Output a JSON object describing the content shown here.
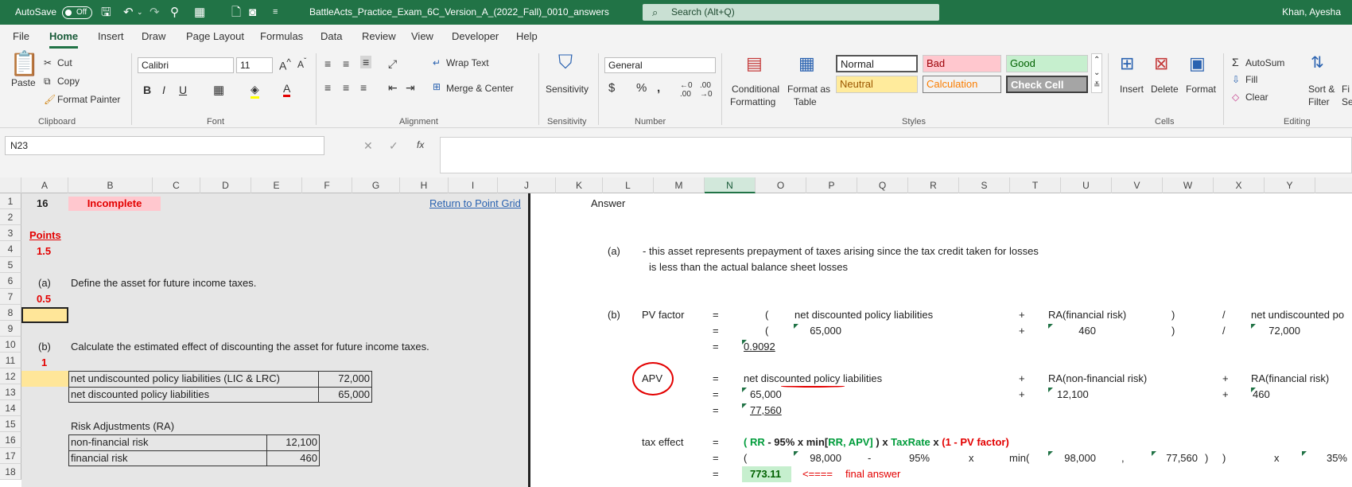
{
  "titlebar": {
    "autosave": "AutoSave",
    "toggle": "Off",
    "filename": "BattleActs_Practice_Exam_6C_Version_A_(2022_Fall)_0010_answers",
    "search": "Search (Alt+Q)",
    "user": "Khan, Ayesha"
  },
  "tabs": [
    "File",
    "Home",
    "Insert",
    "Draw",
    "Page Layout",
    "Formulas",
    "Data",
    "Review",
    "View",
    "Developer",
    "Help"
  ],
  "ribbon": {
    "clipboard": {
      "paste": "Paste",
      "cut": "Cut",
      "copy": "Copy",
      "format_painter": "Format Painter",
      "group": "Clipboard"
    },
    "font": {
      "name": "Calibri",
      "size": "11",
      "group": "Font",
      "bold": "B",
      "italic": "I",
      "underline": "U"
    },
    "alignment": {
      "wrap": "Wrap Text",
      "merge": "Merge & Center",
      "group": "Alignment"
    },
    "sensitivity": {
      "label": "Sensitivity",
      "group": "Sensitivity"
    },
    "number": {
      "format": "General",
      "group": "Number"
    },
    "styles": {
      "conditional": "Conditional",
      "formatting": "Formatting",
      "format_as": "Format as",
      "table": "Table",
      "normal": "Normal",
      "bad": "Bad",
      "good": "Good",
      "neutral": "Neutral",
      "calculation": "Calculation",
      "check_cell": "Check Cell",
      "group": "Styles"
    },
    "cells": {
      "insert": "Insert",
      "delete": "Delete",
      "format": "Format",
      "group": "Cells"
    },
    "editing": {
      "autosum": "AutoSum",
      "fill": "Fill",
      "clear": "Clear",
      "sort": "Sort &",
      "filter": "Filter",
      "find": "Fi",
      "select": "Sel",
      "group": "Editing"
    }
  },
  "formula_bar": {
    "name_box": "N23",
    "fx": "fx"
  },
  "columns": [
    "A",
    "B",
    "C",
    "D",
    "E",
    "F",
    "G",
    "H",
    "I",
    "J",
    "K",
    "L",
    "M",
    "N",
    "O",
    "P",
    "Q",
    "R",
    "S",
    "T",
    "U",
    "V",
    "W",
    "X",
    "Y"
  ],
  "rows": [
    "1",
    "2",
    "3",
    "4",
    "5",
    "6",
    "7",
    "8",
    "9",
    "10",
    "11",
    "12",
    "13",
    "14",
    "15",
    "16",
    "17",
    "18"
  ],
  "left": {
    "q_num": "16",
    "status": "Incomplete",
    "return_link": "Return to Point Grid",
    "points_label": "Points",
    "points": "1.5",
    "a_label": "(a)",
    "a_text": "Define the asset for future income taxes.",
    "a_points": "0.5",
    "b_label": "(b)",
    "b_text": "Calculate the estimated effect of discounting the asset for future income taxes.",
    "b_points": "1",
    "undisc_label": "net undiscounted policy liabilities (LIC & LRC)",
    "undisc_val": "72,000",
    "disc_label": "net discounted policy liabilities",
    "disc_val": "65,000",
    "ra_title": "Risk Adjustments (RA)",
    "nonfin_label": "non-financial risk",
    "nonfin_val": "12,100",
    "fin_label": "financial risk",
    "fin_val": "460"
  },
  "right": {
    "answer": "Answer",
    "a_label": "(a)",
    "a_line1": "- this asset represents prepayment of taxes arising since the tax credit taken for losses",
    "a_line2": "is less than the actual balance sheet losses",
    "b_label": "(b)",
    "pv_label": "PV factor",
    "eq": "=",
    "lp": "(",
    "rp": ")",
    "plus": "+",
    "slash": "/",
    "x": "x",
    "minus": "-",
    "comma": ",",
    "ndpl": "net discounted policy liabilities",
    "ra_fin": "RA(financial risk)",
    "nupl": "net undiscounted po",
    "v65": "65,000",
    "v460": "460",
    "v72": "72,000",
    "pv": "0.9092",
    "apv": "APV",
    "ndpl2": "net discounted policy liabilities",
    "ra_nonfin": "RA(non-financial risk)",
    "ra_fin2": "RA(financial risk)",
    "v12100": "12,100",
    "apv_val": "77,560",
    "tax_label": "tax effect",
    "f_rr": "( RR",
    "f_mid": " - 95% x min[",
    "f_rrapv": "RR, APV]",
    "f_close": " ) x ",
    "f_tax": "TaxRate",
    "f_x": " x ",
    "f_pv": "(1 - PV factor)",
    "v98": "98,000",
    "p95": "95%",
    "min": "min(",
    "v98b": "98,000",
    "v77560": "77,560",
    "p35": "35%",
    "final_val": "773.11",
    "arrow": "<====",
    "final": "final answer"
  },
  "colors": {
    "excel_green": "#217346",
    "input_yellow": "#ffe699",
    "incomplete_pink": "#ffc7ce",
    "result_green": "#c6efce",
    "ink_red": "#e30000"
  }
}
